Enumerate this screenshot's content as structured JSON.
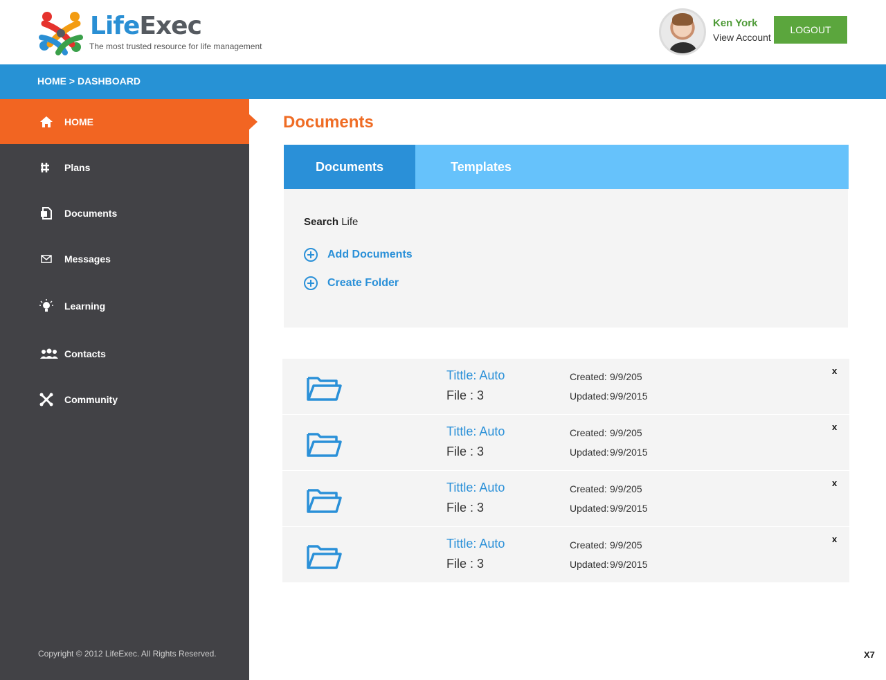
{
  "header": {
    "logo_part1": "Life",
    "logo_part2": "Exec",
    "tagline": "The most trusted resource for life management",
    "user_name": "Ken York",
    "view_account": "View Account",
    "logout_label": "LOGOUT"
  },
  "breadcrumb": "HOME > DASHBOARD",
  "sidebar": {
    "items": [
      {
        "label": "HOME",
        "icon": "home-icon",
        "active": true
      },
      {
        "label": "Plans",
        "icon": "plans-icon"
      },
      {
        "label": "Documents",
        "icon": "documents-icon"
      },
      {
        "label": "Messages",
        "icon": "envelope-icon"
      },
      {
        "label": "Learning",
        "icon": "lightbulb-icon"
      },
      {
        "label": "Contacts",
        "icon": "people-icon"
      },
      {
        "label": "Community",
        "icon": "community-icon"
      }
    ],
    "copyright": "Copyright © 2012 LifeExec. All Rights Reserved."
  },
  "main": {
    "title": "Documents",
    "tabs": [
      {
        "label": "Documents",
        "active": true
      },
      {
        "label": "Templates"
      }
    ],
    "search_label_bold": "Search",
    "search_label_rest": " Life",
    "actions": [
      {
        "label": "Add Documents"
      },
      {
        "label": "Create Folder"
      }
    ],
    "documents": [
      {
        "title": "Tittle: Auto",
        "file": "File : 3",
        "created_label": "Created:",
        "created": "9/9/205",
        "updated_label": "Updated:",
        "updated": "9/9/2015"
      },
      {
        "title": "Tittle: Auto",
        "file": "File : 3",
        "created_label": "Created:",
        "created": "9/9/205",
        "updated_label": "Updated:",
        "updated": "9/9/2015"
      },
      {
        "title": "Tittle: Auto",
        "file": "File : 3",
        "created_label": "Created:",
        "created": "9/9/205",
        "updated_label": "Updated:",
        "updated": "9/9/2015"
      },
      {
        "title": "Tittle: Auto",
        "file": "File : 3",
        "created_label": "Created:",
        "created": "9/9/205",
        "updated_label": "Updated:",
        "updated": "9/9/2015"
      }
    ],
    "close_glyph": "x"
  },
  "corner_label": "X7",
  "colors": {
    "brand_blue": "#2792d5",
    "accent_orange": "#f26522",
    "sidebar_bg": "#424246",
    "logout_green": "#5ba63d",
    "tab_light": "#66c2fb"
  }
}
